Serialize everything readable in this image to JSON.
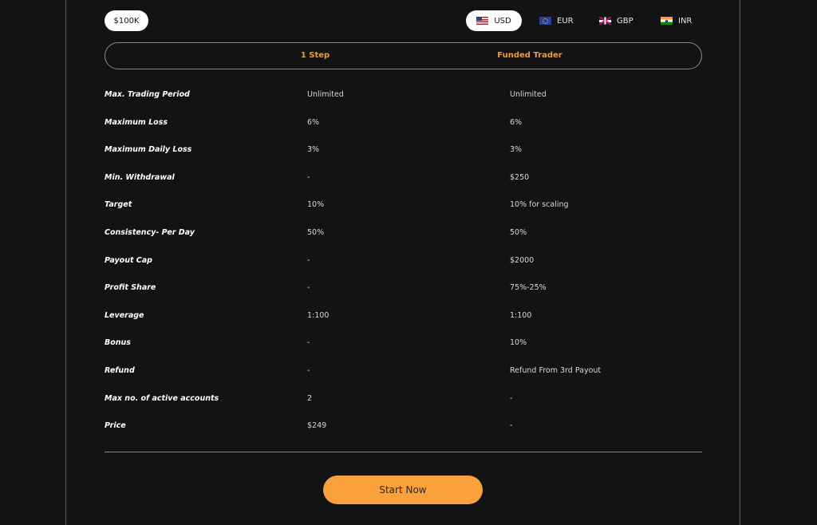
{
  "account_size": "$100K",
  "currencies": [
    {
      "code": "USD",
      "flag": "us-flag-icon",
      "selected": true
    },
    {
      "code": "EUR",
      "flag": "eu-flag-icon",
      "selected": false
    },
    {
      "code": "GBP",
      "flag": "gb-flag-icon",
      "selected": false
    },
    {
      "code": "INR",
      "flag": "in-flag-icon",
      "selected": false
    }
  ],
  "tabs": [
    "1 Step",
    "Funded Trader"
  ],
  "rows": [
    {
      "label": "Max. Trading Period",
      "step": "Unlimited",
      "funded": "Unlimited"
    },
    {
      "label": "Maximum Loss",
      "step": "6%",
      "funded": "6%"
    },
    {
      "label": "Maximum Daily Loss",
      "step": "3%",
      "funded": "3%"
    },
    {
      "label": "Min. Withdrawal",
      "step": "-",
      "funded": "$250"
    },
    {
      "label": "Target",
      "step": "10%",
      "funded": "10% for scaling"
    },
    {
      "label": "Consistency- Per Day",
      "step": "50%",
      "funded": "50%"
    },
    {
      "label": "Payout Cap",
      "step": "-",
      "funded": "$2000"
    },
    {
      "label": "Profit Share",
      "step": "-",
      "funded": "75%-25%"
    },
    {
      "label": "Leverage",
      "step": "1:100",
      "funded": "1:100"
    },
    {
      "label": "Bonus",
      "step": "-",
      "funded": "10%"
    },
    {
      "label": "Refund",
      "step": "-",
      "funded": "Refund From 3rd Payout"
    },
    {
      "label": "Max no. of active accounts",
      "step": "2",
      "funded": "-"
    },
    {
      "label": "Price",
      "step": "$249",
      "funded": "-"
    }
  ],
  "cta_label": "Start Now",
  "colors": {
    "background": "#131313",
    "accent": "#f9a23d",
    "tab_text": "#f39b33"
  }
}
